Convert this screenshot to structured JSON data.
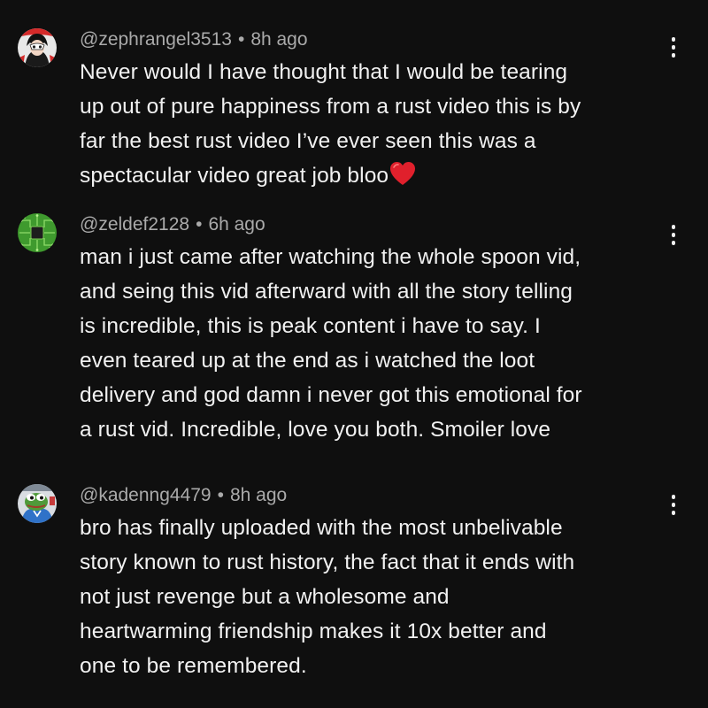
{
  "comments": [
    {
      "handle": "@zephrangel3513",
      "separator": "•",
      "time": "8h ago",
      "lines": [
        "Never would I have thought that I would be tearing",
        "up out of pure happiness from a rust video this is by",
        "far the best rust video I’ve ever seen this was a",
        "spectacular video great job bloo"
      ],
      "emoji": "red-heart-emoji",
      "avatar": "persona-mask-avatar"
    },
    {
      "handle": "@zeldef2128",
      "separator": "•",
      "time": "6h ago",
      "lines": [
        "man i just came after watching the whole spoon vid,",
        "and seing this vid afterward with all the story telling",
        "is incredible, this is peak content i have to say. I",
        "even teared up at the end as i watched the loot",
        "delivery and god damn i never got this emotional for",
        "a rust vid. Incredible, love you both. Smoiler love"
      ],
      "avatar": "circuit-chip-avatar"
    },
    {
      "handle": "@kadenng4479",
      "separator": "•",
      "time": "8h ago",
      "lines": [
        "bro has finally uploaded with the most unbelivable",
        "story known to rust history, the fact that it ends with",
        "not just revenge but a wholesome and",
        "heartwarming friendship makes it 10x better and",
        "one to be remembered."
      ],
      "avatar": "pepe-frog-avatar"
    }
  ],
  "colors": {
    "background": "#0f0f0f",
    "text": "#f1f1f1",
    "meta": "#aaaaaa",
    "heart": "#e0202c"
  },
  "icons": {
    "menu": "more-vertical-icon"
  }
}
